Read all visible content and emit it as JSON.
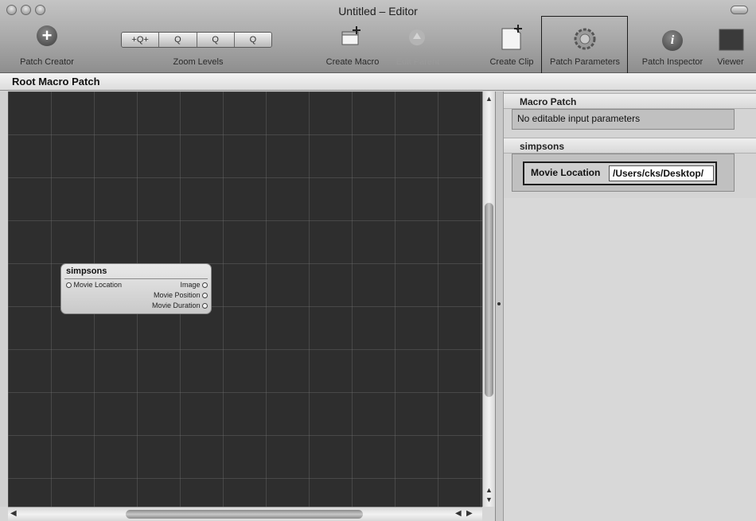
{
  "window": {
    "title": "Untitled – Editor"
  },
  "toolbar": {
    "patch_creator": "Patch Creator",
    "zoom_buttons": [
      "+Q+",
      "Q",
      "Q",
      "Q"
    ],
    "zoom_levels": "Zoom Levels",
    "create_macro": "Create Macro",
    "edit_parent": "Edit Parent",
    "create_clip": "Create Clip",
    "patch_parameters": "Patch Parameters",
    "patch_inspector": "Patch Inspector",
    "viewer": "Viewer"
  },
  "breadcrumb": {
    "title": "Root Macro Patch"
  },
  "patch_node": {
    "title": "simpsons",
    "inputs": [
      "Movie Location"
    ],
    "outputs": [
      "Image",
      "Movie Position",
      "Movie Duration"
    ]
  },
  "inspector": {
    "macro_section_title": "Macro Patch",
    "macro_message": "No editable input parameters",
    "node_section_title": "simpsons",
    "movie_location_label": "Movie Location",
    "movie_location_value": "/Users/cks/Desktop/"
  },
  "colors": {
    "canvas_bg": "#2e2e2e",
    "panel_bg": "#d4d4d4"
  }
}
